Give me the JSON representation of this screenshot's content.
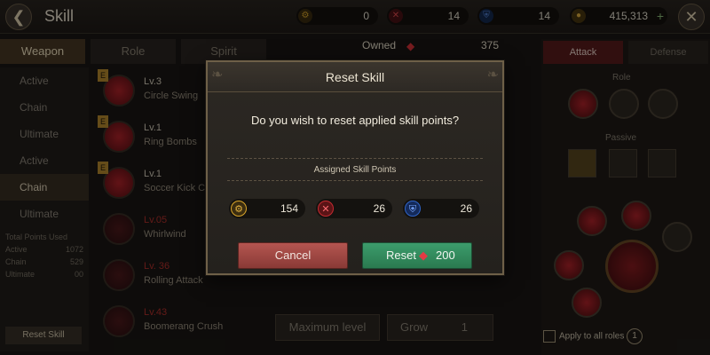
{
  "header": {
    "title": "Skill",
    "back_icon": "back-arrow-icon",
    "close_icon": "close-icon",
    "currencies": [
      {
        "name": "skill-points-gold",
        "icon": "gear-icon",
        "value": "0",
        "color": "#d9a52a"
      },
      {
        "name": "skill-points-red",
        "icon": "cross-icon",
        "value": "14",
        "color": "#c42a30"
      },
      {
        "name": "skill-points-blue",
        "icon": "shield-icon",
        "value": "14",
        "color": "#2f64c8"
      },
      {
        "name": "gold",
        "icon": "coin-icon",
        "value": "415,313",
        "color": "#c99a2e"
      }
    ]
  },
  "tabs": [
    {
      "label": "Weapon",
      "active": true
    },
    {
      "label": "Role",
      "active": false
    },
    {
      "label": "Spirit",
      "active": false
    }
  ],
  "left_panel": {
    "items": [
      {
        "label": "Active",
        "active": false
      },
      {
        "label": "Chain",
        "active": false
      },
      {
        "label": "Ultimate",
        "active": false
      },
      {
        "label": "Active",
        "active": false
      },
      {
        "label": "Chain",
        "active": true
      },
      {
        "label": "Ultimate",
        "active": false
      }
    ],
    "stats_title": "Total Points Used",
    "stats": [
      {
        "label": "Active",
        "value": "1072"
      },
      {
        "label": "Chain",
        "value": "529"
      },
      {
        "label": "Ultimate",
        "value": "00"
      }
    ],
    "reset_label": "Reset Skill"
  },
  "skills": [
    {
      "level": "Lv.3",
      "name": "Circle Swing",
      "badge": "E",
      "locked": false
    },
    {
      "level": "Lv.1",
      "name": "Ring Bombs",
      "badge": "E",
      "locked": false
    },
    {
      "level": "Lv.1",
      "name": "Soccer Kick Co",
      "badge": "E",
      "locked": false
    },
    {
      "level": "Lv.05",
      "name": "Whirlwind",
      "badge": "",
      "locked": true
    },
    {
      "level": "Lv. 36",
      "name": "Rolling Attack",
      "badge": "",
      "locked": true
    },
    {
      "level": "Lv.43",
      "name": "Boomerang Crush",
      "badge": "",
      "locked": true
    }
  ],
  "owned": {
    "label": "Owned",
    "value": "375",
    "icon": "ruby-icon"
  },
  "right_panel": {
    "attack_label": "Attack",
    "defense_label": "Defense",
    "role_label": "Role",
    "passive_label": "Passive",
    "apply_all_label": "Apply to all roles",
    "slot_count": "1"
  },
  "bottom": {
    "max_level_label": "Maximum level",
    "grow_label": "Grow",
    "grow_value": "1"
  },
  "dialog": {
    "title": "Reset Skill",
    "question": "Do you wish to reset applied skill points?",
    "assigned_label": "Assigned Skill Points",
    "points": [
      {
        "icon": "gear-icon",
        "value": "154",
        "color": "#d9a52a"
      },
      {
        "icon": "cross-icon",
        "value": "26",
        "color": "#c42a30"
      },
      {
        "icon": "shield-icon",
        "value": "26",
        "color": "#2f64c8"
      }
    ],
    "cancel_label": "Cancel",
    "reset_label": "Reset",
    "reset_cost": "200",
    "reset_cost_icon": "ruby-icon"
  }
}
